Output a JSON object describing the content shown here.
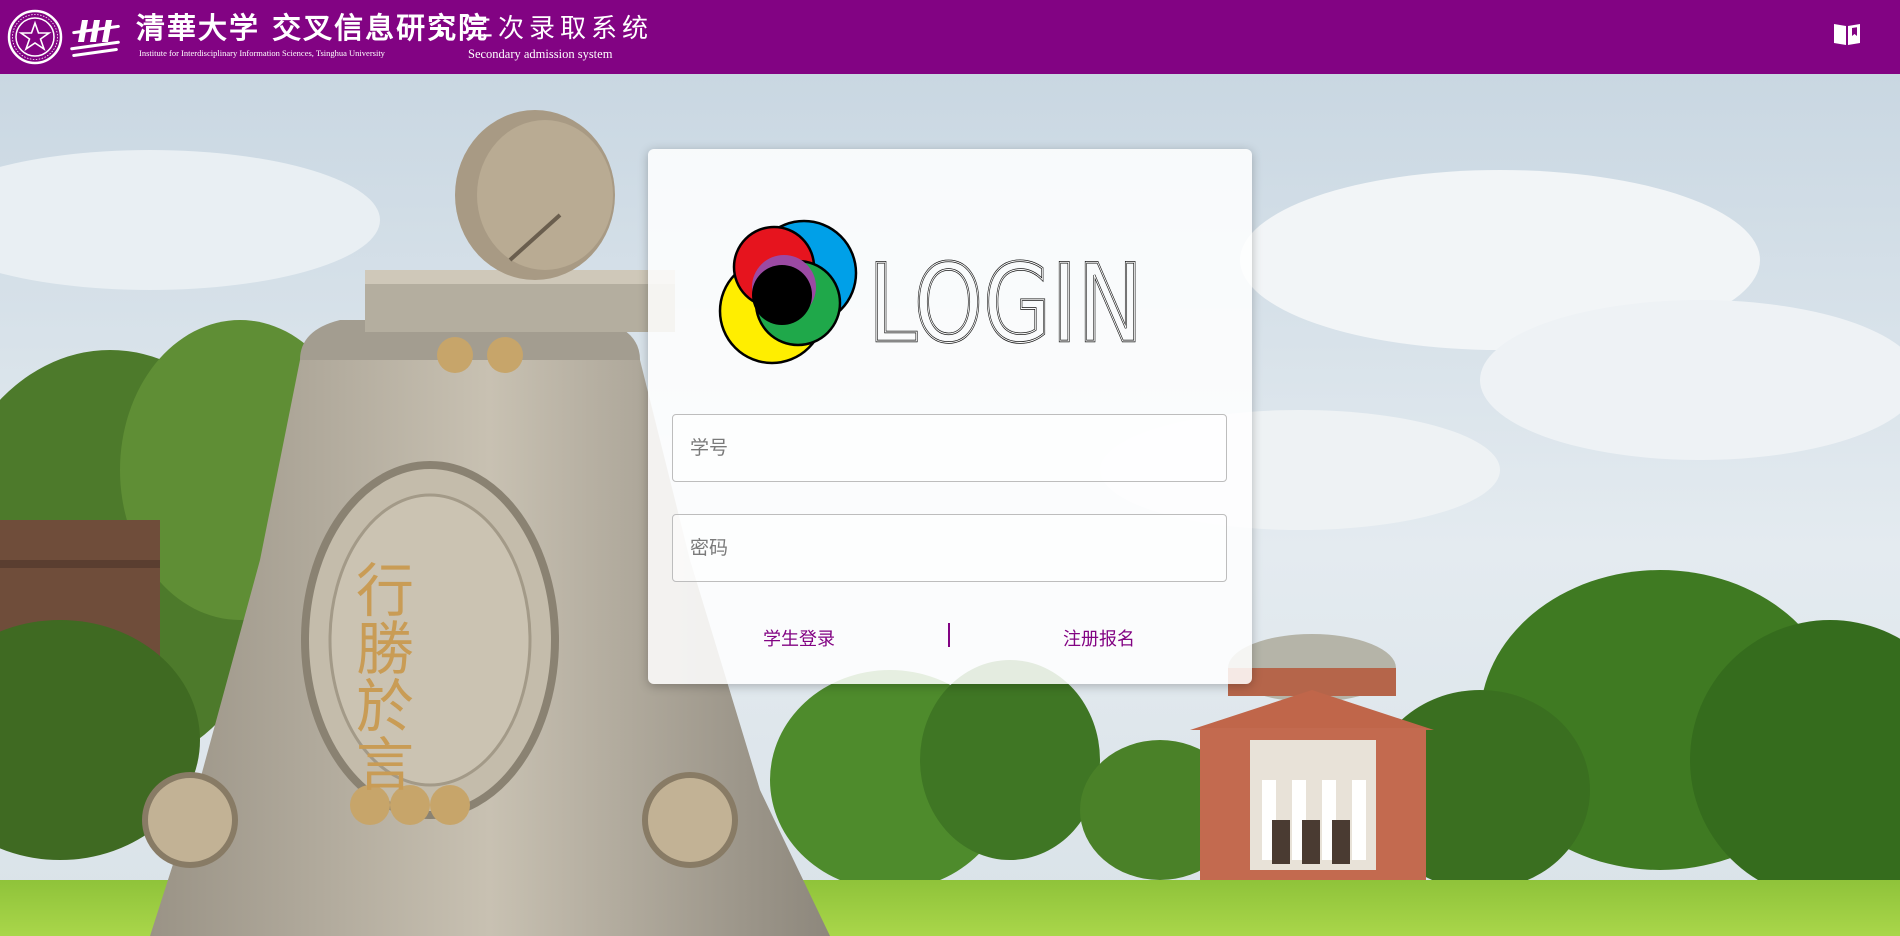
{
  "header": {
    "brand_cn": "清華大学 交叉信息研究院",
    "brand_en": "Institute for Interdisciplinary Information Sciences, Tsinghua University",
    "system_cn": "二次录取系统",
    "system_en": "Secondary admission system",
    "bg_color": "#820383",
    "right_icon": "book-icon"
  },
  "login": {
    "heading": "LOGIN",
    "student_id_placeholder": "学号",
    "password_placeholder": "密码",
    "student_login_label": "学生登录",
    "register_label": "注册报名",
    "accent_color": "#820383"
  },
  "background": {
    "inscription": "行勝於言"
  }
}
